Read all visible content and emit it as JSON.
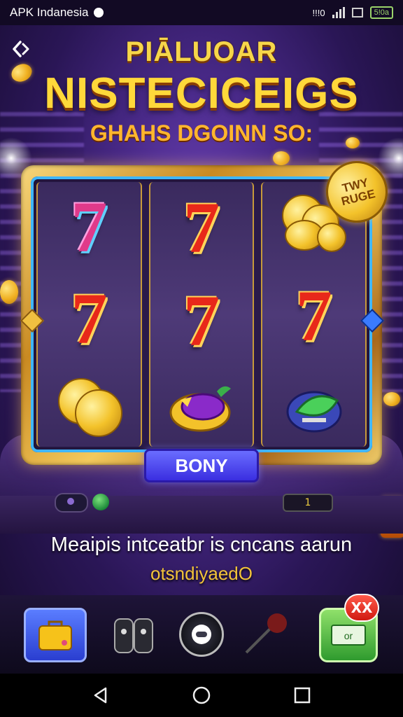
{
  "status_bar": {
    "app_name": "APK Indanesia",
    "signal_text": "!!!0",
    "battery_text": "5!0a"
  },
  "header": {
    "title_top": "PIĀLUOAR",
    "title_main": "NISTECICEIGS",
    "subtitle": "GHAHS DGOINN SO:"
  },
  "machine": {
    "coin_badge_text": "TWY\nRUGE",
    "reels": [
      [
        "seven-purple",
        "seven",
        "coins"
      ],
      [
        "seven",
        "seven",
        "fruit"
      ],
      [
        "coins",
        "seven",
        "gem"
      ]
    ],
    "bonus_button_label": "BONY",
    "credit_display": "1"
  },
  "messages": {
    "line1": "Meaipis intceatbr is cncans aarun",
    "line2": "otsndiyaedO"
  },
  "bottom_bar": {
    "items": [
      "briefcase-icon",
      "masks-icon",
      "chip-icon",
      "cue-icon",
      "cash-icon"
    ],
    "notification_badge": "XX"
  },
  "colors": {
    "background": "#2a1656",
    "title_gold": "#ffd83a",
    "seven_red": "#e8281a",
    "bonus_blue": "#3a2ee0",
    "frame_gold": "#c98a22"
  }
}
